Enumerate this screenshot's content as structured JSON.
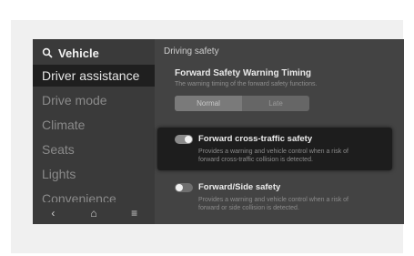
{
  "sidebar": {
    "header": {
      "label": "Vehicle"
    },
    "items": [
      {
        "label": "Driver assistance",
        "active": true
      },
      {
        "label": "Drive mode"
      },
      {
        "label": "Climate"
      },
      {
        "label": "Seats"
      },
      {
        "label": "Lights"
      },
      {
        "label": "Convenience"
      }
    ],
    "nav": [
      {
        "icon": "back-icon",
        "glyph": "‹"
      },
      {
        "icon": "home-icon",
        "glyph": "⌂"
      },
      {
        "icon": "menu-icon",
        "glyph": "≡"
      }
    ]
  },
  "main": {
    "breadcrumb": "Driving safety",
    "warning_timing": {
      "title": "Forward Safety Warning Timing",
      "description": "The warning timing of the forward safety functions.",
      "options": [
        "Normal",
        "Late"
      ],
      "selected": "Normal"
    },
    "settings": [
      {
        "title": "Forward cross-traffic safety",
        "description": [
          "Provides a warning and vehicle control when a risk of",
          "forward cross-traffic collision is detected."
        ],
        "enabled": true
      },
      {
        "title": "Forward/Side safety",
        "description": [
          "Provides a warning and vehicle control when a risk of",
          "forward or side collision is detected."
        ],
        "enabled": false
      }
    ]
  }
}
